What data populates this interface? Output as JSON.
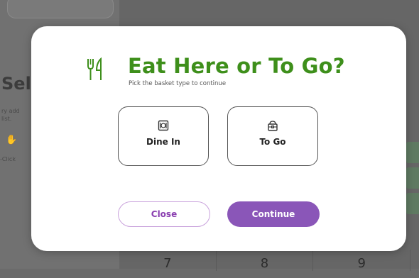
{
  "background": {
    "title_fragment": "Sel",
    "text_line_1": "ry add",
    "text_line_2": "list.",
    "text_line_3": "-Click",
    "keypad": [
      "7",
      "8",
      "9"
    ]
  },
  "modal": {
    "icon": "fork-knife-icon",
    "title": "Eat Here or To Go?",
    "subtitle": "Pick the basket type to continue",
    "options": [
      {
        "label": "Dine In",
        "icon": "dine-in-icon"
      },
      {
        "label": "To Go",
        "icon": "takeout-bag-icon"
      }
    ],
    "close_label": "Close",
    "continue_label": "Continue"
  },
  "colors": {
    "title_green": "#3e8f1b",
    "accent_purple": "#8a56b8",
    "close_border": "#c9a2dc"
  }
}
